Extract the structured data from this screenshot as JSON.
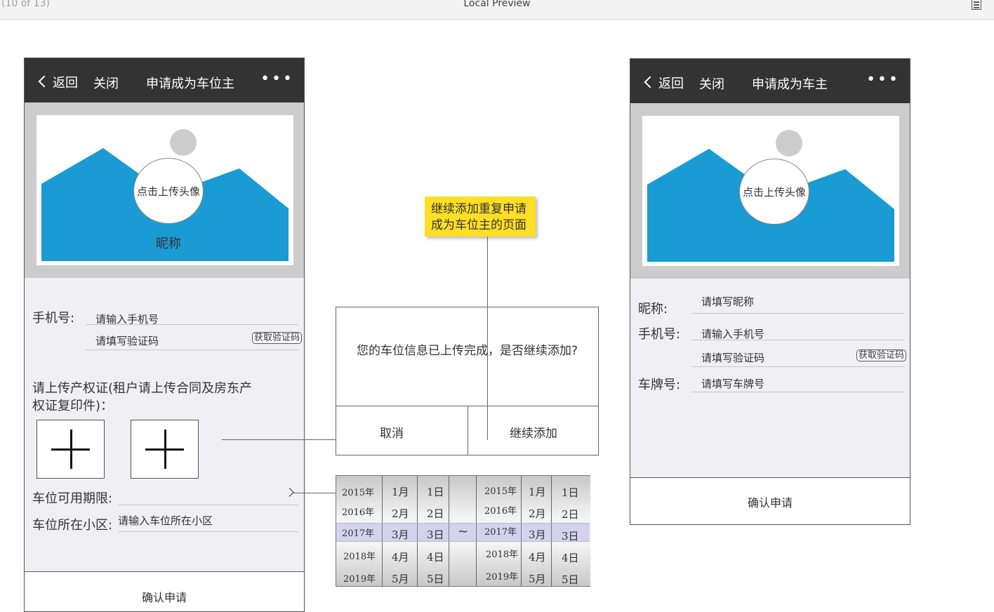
{
  "topbar": {
    "page_counter": "(10 of 13)",
    "title": "Local Preview",
    "menu_icon": "document-icon"
  },
  "phone_left": {
    "header": {
      "back": "返回",
      "close": "关闭",
      "title": "申请成为车位主",
      "more": "•••"
    },
    "avatar_text": "点击上传头像",
    "nickname": "昵称",
    "phone_label": "手机号:",
    "phone_placeholder": "请输入手机号",
    "code_placeholder": "请填写验证码",
    "code_button": "获取验证码",
    "upload_label_1": "请上传产权证(租户请上传合同及房东产",
    "upload_label_2": "权证复印件)：",
    "period_label": "车位可用期限:",
    "community_label": "车位所在小区:",
    "community_placeholder": "请输入车位所在小区",
    "submit": "确认申请"
  },
  "note": {
    "line1": "继续添加重复申请",
    "line2": "成为车位主的页面"
  },
  "dialog": {
    "message": "您的车位信息已上传完成，是否继续添加?",
    "cancel": "取消",
    "confirm": "继续添加"
  },
  "picker": {
    "years": [
      "2015年",
      "2016年",
      "2017年",
      "2018年",
      "2019年"
    ],
    "months": [
      "1月",
      "2月",
      "3月",
      "4月",
      "5月"
    ],
    "days": [
      "1日",
      "2日",
      "3日",
      "4日",
      "5日"
    ],
    "separator": "~",
    "selected_index": 2
  },
  "phone_right": {
    "header": {
      "back": "返回",
      "close": "关闭",
      "title": "申请成为车主",
      "more": "•••"
    },
    "avatar_text": "点击上传头像",
    "nickname_label": "昵称:",
    "nickname_placeholder": "请填写昵称",
    "phone_label": "手机号:",
    "phone_placeholder": "请输入手机号",
    "code_placeholder": "请填写验证码",
    "code_button": "获取验证码",
    "plate_label": "车牌号:",
    "plate_placeholder": "请填写车牌号",
    "submit": "确认申请"
  },
  "colors": {
    "header_bg": "#333333",
    "mountain": "#1a9bd4",
    "note_bg": "#ffdf25",
    "picker_highlight": "#b8b8e0"
  }
}
